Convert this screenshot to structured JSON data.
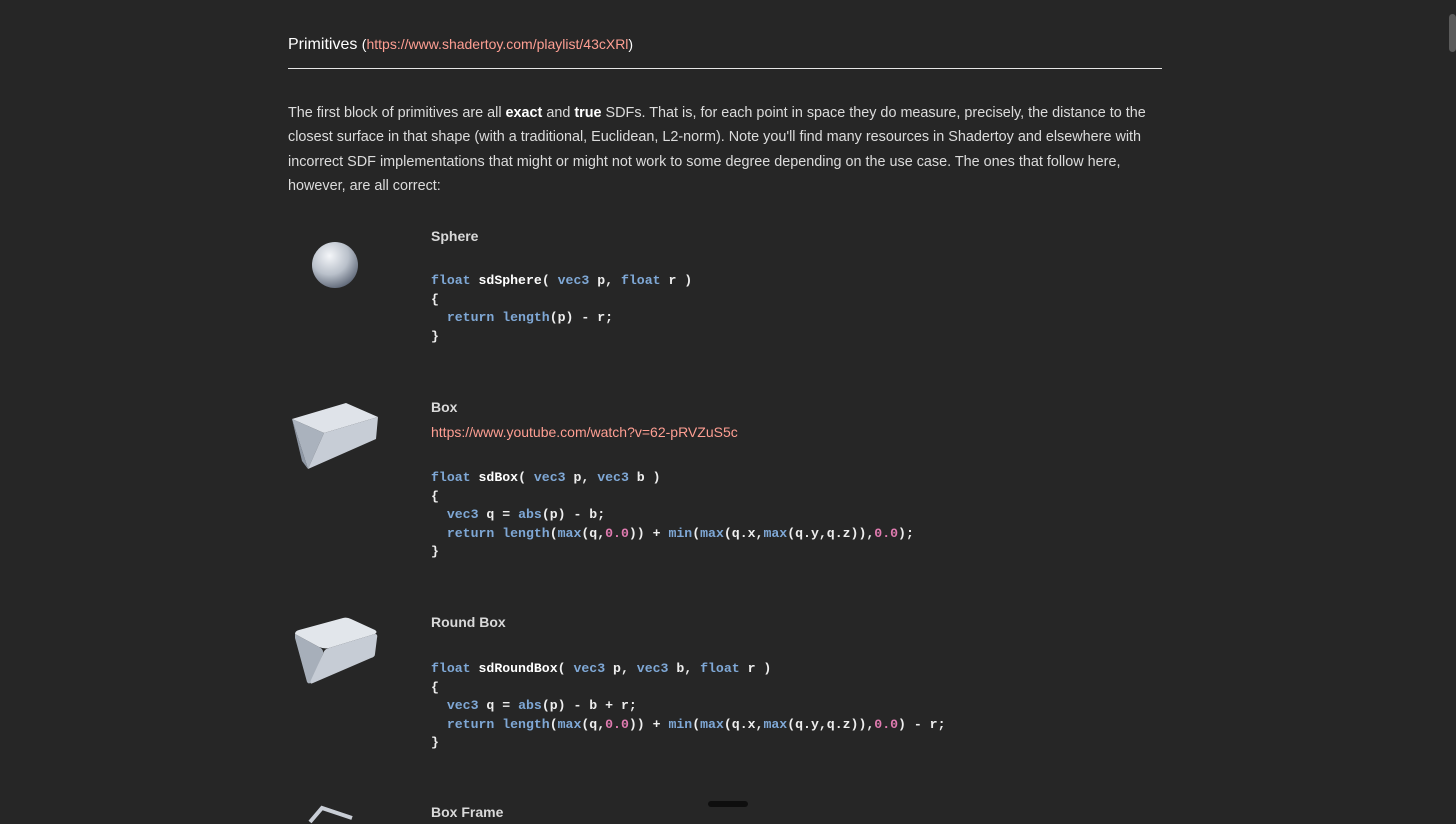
{
  "header": {
    "title": "Primitives",
    "paren_open": "(",
    "link": "https://www.shadertoy.com/playlist/43cXRl",
    "paren_close": ")"
  },
  "intro": {
    "t1": "The first block of primitives are all ",
    "b1": "exact",
    "t2": " and ",
    "b2": "true",
    "t3": " SDFs. That is, for each point in space they do measure, precisely, the distance to the closest surface in that shape (with a traditional, Euclidean, L2-norm). Note you'll find many resources in Shadertoy and elsewhere with incorrect SDF implementations that might or might not work to some degree depending on the use case. The ones that follow here, however, are all correct:"
  },
  "sections": [
    {
      "title": "Sphere",
      "code": [
        [
          [
            "kw",
            "float"
          ],
          [
            "fn",
            " sdSphere"
          ],
          [
            "t",
            "( "
          ],
          [
            "kw",
            "vec3"
          ],
          [
            "t",
            " p, "
          ],
          [
            "kw",
            "float"
          ],
          [
            "t",
            " r )"
          ]
        ],
        [
          [
            "t",
            "{"
          ]
        ],
        [
          [
            "t",
            "  "
          ],
          [
            "kw",
            "return"
          ],
          [
            "t",
            " "
          ],
          [
            "kw",
            "length"
          ],
          [
            "t",
            "(p) - r;"
          ]
        ],
        [
          [
            "t",
            "}"
          ]
        ]
      ]
    },
    {
      "title": "Box",
      "link": "https://www.youtube.com/watch?v=62-pRVZuS5c",
      "code": [
        [
          [
            "kw",
            "float"
          ],
          [
            "fn",
            " sdBox"
          ],
          [
            "t",
            "( "
          ],
          [
            "kw",
            "vec3"
          ],
          [
            "t",
            " p, "
          ],
          [
            "kw",
            "vec3"
          ],
          [
            "t",
            " b )"
          ]
        ],
        [
          [
            "t",
            "{"
          ]
        ],
        [
          [
            "t",
            "  "
          ],
          [
            "kw",
            "vec3"
          ],
          [
            "t",
            " q = "
          ],
          [
            "kw",
            "abs"
          ],
          [
            "t",
            "(p) - b;"
          ]
        ],
        [
          [
            "t",
            "  "
          ],
          [
            "kw",
            "return"
          ],
          [
            "t",
            " "
          ],
          [
            "kw",
            "length"
          ],
          [
            "t",
            "("
          ],
          [
            "kw",
            "max"
          ],
          [
            "t",
            "(q,"
          ],
          [
            "num",
            "0.0"
          ],
          [
            "t",
            ")) + "
          ],
          [
            "kw",
            "min"
          ],
          [
            "t",
            "("
          ],
          [
            "kw",
            "max"
          ],
          [
            "t",
            "(q.x,"
          ],
          [
            "kw",
            "max"
          ],
          [
            "t",
            "(q.y,q.z)),"
          ],
          [
            "num",
            "0.0"
          ],
          [
            "t",
            ");"
          ]
        ],
        [
          [
            "t",
            "}"
          ]
        ]
      ]
    },
    {
      "title": "Round Box",
      "code": [
        [
          [
            "kw",
            "float"
          ],
          [
            "fn",
            " sdRoundBox"
          ],
          [
            "t",
            "( "
          ],
          [
            "kw",
            "vec3"
          ],
          [
            "t",
            " p, "
          ],
          [
            "kw",
            "vec3"
          ],
          [
            "t",
            " b, "
          ],
          [
            "kw",
            "float"
          ],
          [
            "t",
            " r )"
          ]
        ],
        [
          [
            "t",
            "{"
          ]
        ],
        [
          [
            "t",
            "  "
          ],
          [
            "kw",
            "vec3"
          ],
          [
            "t",
            " q = "
          ],
          [
            "kw",
            "abs"
          ],
          [
            "t",
            "(p) - b + r;"
          ]
        ],
        [
          [
            "t",
            "  "
          ],
          [
            "kw",
            "return"
          ],
          [
            "t",
            " "
          ],
          [
            "kw",
            "length"
          ],
          [
            "t",
            "("
          ],
          [
            "kw",
            "max"
          ],
          [
            "t",
            "(q,"
          ],
          [
            "num",
            "0.0"
          ],
          [
            "t",
            ")) + "
          ],
          [
            "kw",
            "min"
          ],
          [
            "t",
            "("
          ],
          [
            "kw",
            "max"
          ],
          [
            "t",
            "(q.x,"
          ],
          [
            "kw",
            "max"
          ],
          [
            "t",
            "(q.y,q.z)),"
          ],
          [
            "num",
            "0.0"
          ],
          [
            "t",
            ") - r;"
          ]
        ],
        [
          [
            "t",
            "}"
          ]
        ]
      ]
    },
    {
      "title": "Box Frame"
    }
  ]
}
